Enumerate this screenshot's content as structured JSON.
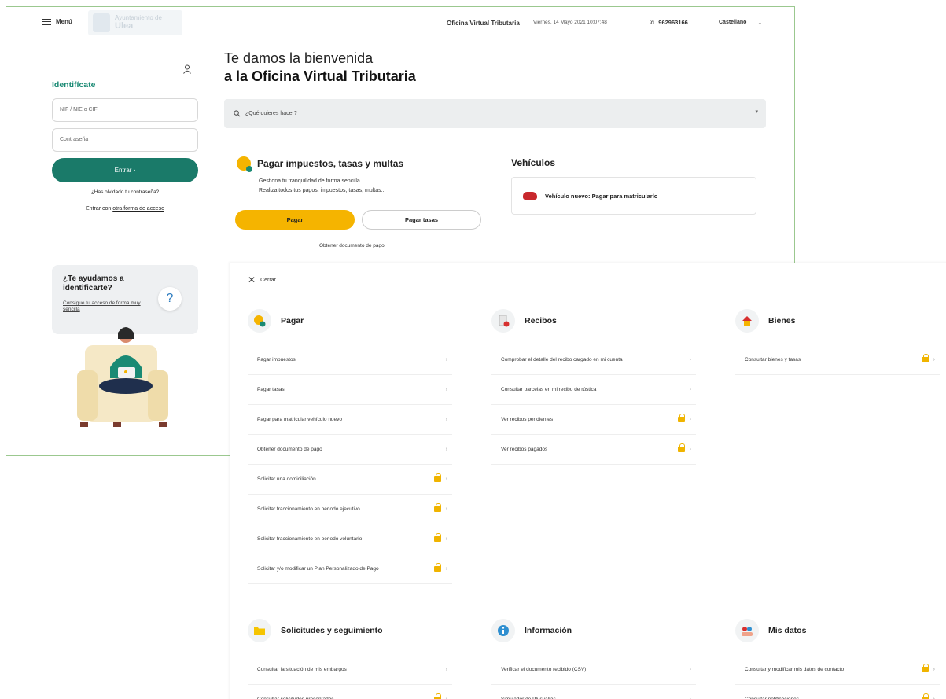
{
  "topbar": {
    "menu_label": "Menú",
    "logo_line1": "Ayuntamiento de",
    "logo_line2": "Ulea",
    "office_title": "Oficina Virtual Tributaria",
    "datetime": "Viernes, 14 Mayo 2021 10:07:48",
    "phone": "962963166",
    "language": "Castellano"
  },
  "login": {
    "title": "Identifícate",
    "nif_placeholder": "NIF / NIE o CIF",
    "password_placeholder": "Contraseña",
    "enter_label": "Entrar  ›",
    "forgot_label": "¿Has olvidado tu contraseña?",
    "alt_prefix": "Entrar con ",
    "alt_link": "otra forma de acceso"
  },
  "help": {
    "title": "¿Te ayudamos a identificarte?",
    "link": "Consigue tu acceso de forma muy sencilla",
    "icon": "?"
  },
  "welcome": {
    "line1": "Te damos la bienvenida",
    "line2": "a la Oficina Virtual Tributaria",
    "search_placeholder": "¿Qué quieres hacer?"
  },
  "pay_card": {
    "title": "Pagar impuestos, tasas y multas",
    "desc1": "Gestiona tu tranquilidad de forma sencilla.",
    "desc2": "Realiza todos tus pagos: impuestos, tasas, multas...",
    "pay_button": "Pagar",
    "fees_button": "Pagar tasas",
    "obtain_link": "Obtener documento de pago"
  },
  "vehicles": {
    "title": "Vehículos",
    "item": "Vehículo nuevo: Pagar para matricularlo"
  },
  "menu_overlay": {
    "close_label": "Cerrar",
    "sections": [
      {
        "title": "Pagar",
        "icon": "coin-icon",
        "items": [
          {
            "label": "Pagar impuestos",
            "locked": false
          },
          {
            "label": "Pagar tasas",
            "locked": false
          },
          {
            "label": "Pagar para matricular vehículo nuevo",
            "locked": false
          },
          {
            "label": "Obtener documento de pago",
            "locked": false
          },
          {
            "label": "Solicitar una domiciliación",
            "locked": true
          },
          {
            "label": "Solicitar fraccionamiento en periodo ejecutivo",
            "locked": true
          },
          {
            "label": "Solicitar fraccionamiento en periodo voluntario",
            "locked": true
          },
          {
            "label": "Solicitar y/o modificar un Plan Personalizado de Pago",
            "locked": true
          }
        ]
      },
      {
        "title": "Recibos",
        "icon": "receipt-icon",
        "items": [
          {
            "label": "Comprobar el detalle del recibo cargado en mi cuenta",
            "locked": false
          },
          {
            "label": "Consultar parcelas en mi recibo de rústica",
            "locked": false
          },
          {
            "label": "Ver recibos pendientes",
            "locked": true
          },
          {
            "label": "Ver recibos pagados",
            "locked": true
          }
        ]
      },
      {
        "title": "Bienes",
        "icon": "house-icon",
        "items": [
          {
            "label": "Consultar bienes y tasas",
            "locked": true
          }
        ]
      },
      {
        "title": "Solicitudes y seguimiento",
        "icon": "folder-icon",
        "items": [
          {
            "label": "Consultar la situación de mis embargos",
            "locked": false
          },
          {
            "label": "Consultar solicitudes presentadas",
            "locked": true
          }
        ]
      },
      {
        "title": "Información",
        "icon": "info-icon",
        "items": [
          {
            "label": "Verificar el documento recibido (CSV)",
            "locked": false
          },
          {
            "label": "Simulador de Plusvalías",
            "locked": false
          }
        ]
      },
      {
        "title": "Mis datos",
        "icon": "people-icon",
        "items": [
          {
            "label": "Consultar y modificar mis datos de contacto",
            "locked": true
          },
          {
            "label": "Consultar notificaciones",
            "locked": true
          }
        ]
      }
    ]
  },
  "colors": {
    "accent_green": "#1a7a69",
    "accent_yellow": "#f5b400",
    "window_border": "#9bc88f"
  }
}
